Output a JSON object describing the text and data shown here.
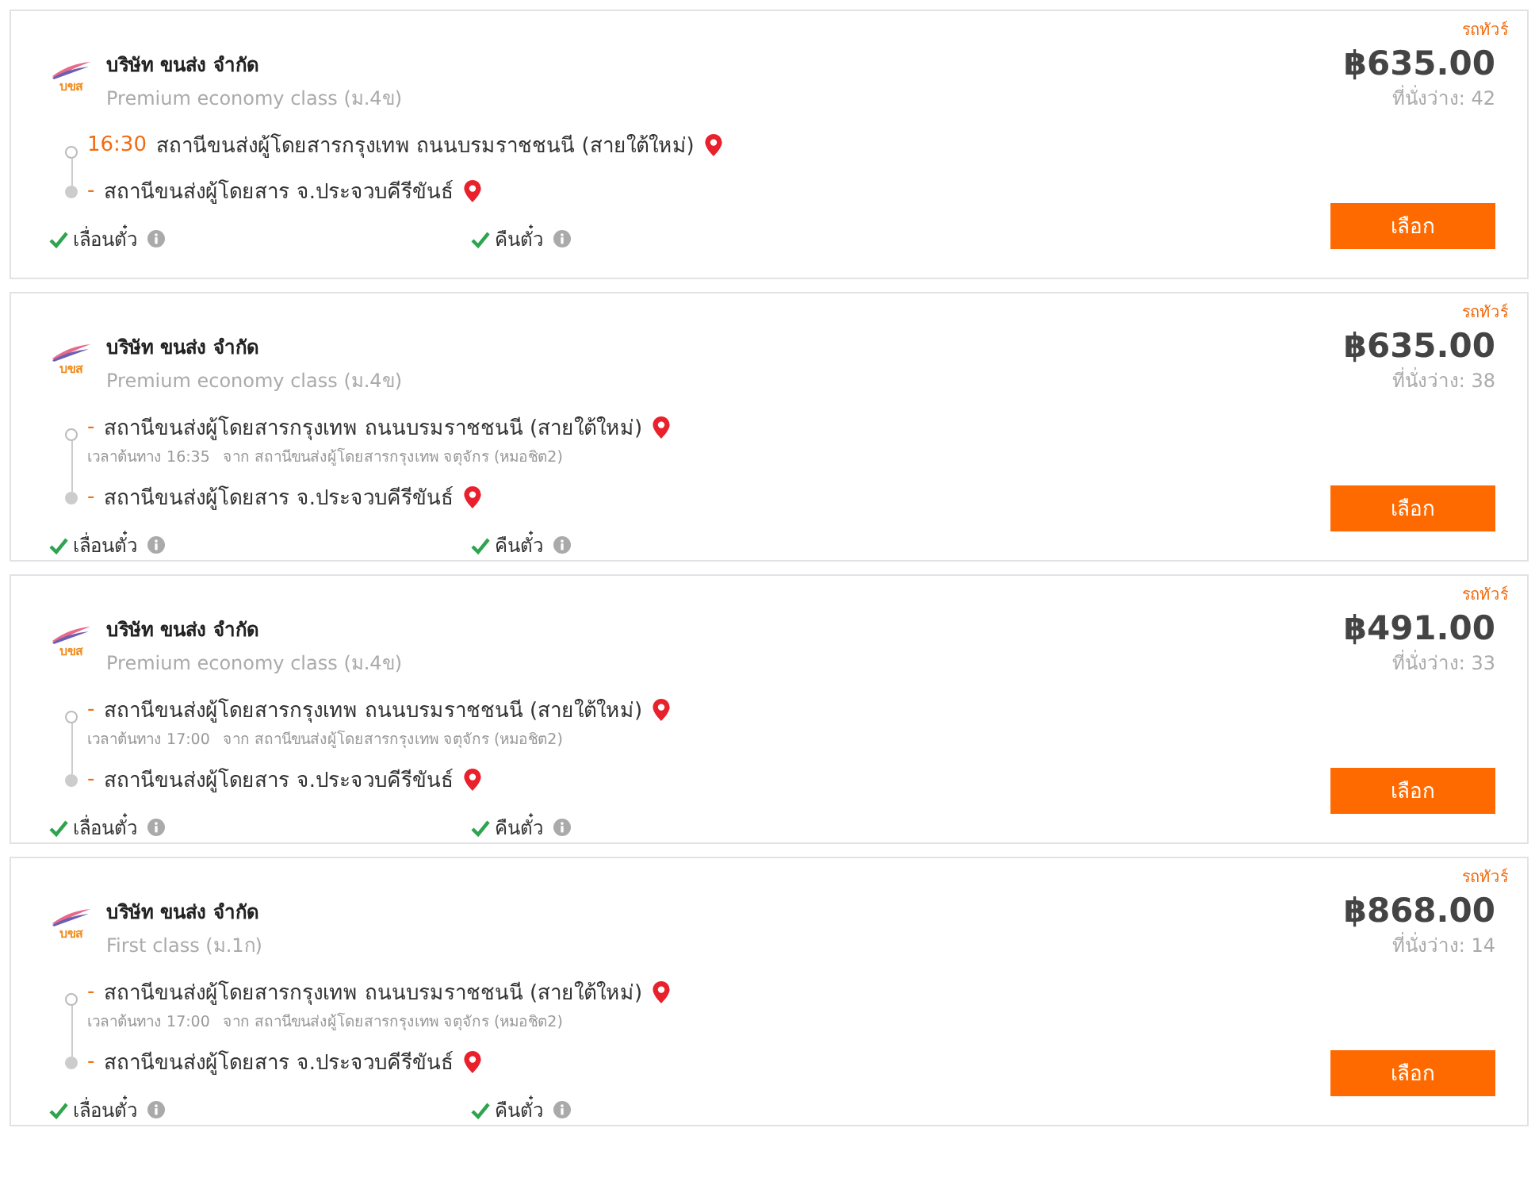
{
  "trips": [
    {
      "bus_type": "รถทัวร์",
      "logo_text": "บขส",
      "company": "บริษัท ขนส่ง จำกัด",
      "class": "Premium economy class (ม.4ข)",
      "price": "฿635.00",
      "seats": "ที่นั่งว่าง: 42",
      "departure": {
        "time": "16:30",
        "station": "สถานีขนส่งผู้โดยสารกรุงเทพ ถนนบรมราชชนนี (สายใต้ใหม่)"
      },
      "arrival": {
        "time": "-",
        "station": "สถานีขนส่งผู้โดยสาร จ.ประจวบคีรีขันธ์"
      },
      "features": [
        {
          "label": "เลื่อนตั๋ว",
          "checked": true
        },
        {
          "label": "คืนตั๋ว",
          "checked": true
        }
      ],
      "button": "เลือก"
    },
    {
      "bus_type": "รถทัวร์",
      "logo_text": "บขส",
      "company": "บริษัท ขนส่ง จำกัด",
      "class": "Premium economy class (ม.4ข)",
      "price": "฿635.00",
      "seats": "ที่นั่งว่าง: 38",
      "departure": {
        "time": "-",
        "station": "สถานีขนส่งผู้โดยสารกรุงเทพ ถนนบรมราชชนนี (สายใต้ใหม่)",
        "origin_time": "เวลาต้นทาง 16:35",
        "origin": "จาก สถานีขนส่งผู้โดยสารกรุงเทพ จตุจักร (หมอชิต2)"
      },
      "arrival": {
        "time": "-",
        "station": "สถานีขนส่งผู้โดยสาร จ.ประจวบคีรีขันธ์"
      },
      "features": [
        {
          "label": "เลื่อนตั๋ว",
          "checked": true
        },
        {
          "label": "คืนตั๋ว",
          "checked": true
        }
      ],
      "button": "เลือก"
    },
    {
      "bus_type": "รถทัวร์",
      "logo_text": "บขส",
      "company": "บริษัท ขนส่ง จำกัด",
      "class": "Premium economy class (ม.4ข)",
      "price": "฿491.00",
      "seats": "ที่นั่งว่าง: 33",
      "departure": {
        "time": "-",
        "station": "สถานีขนส่งผู้โดยสารกรุงเทพ ถนนบรมราชชนนี (สายใต้ใหม่)",
        "origin_time": "เวลาต้นทาง 17:00",
        "origin": "จาก สถานีขนส่งผู้โดยสารกรุงเทพ จตุจักร (หมอชิต2)"
      },
      "arrival": {
        "time": "-",
        "station": "สถานีขนส่งผู้โดยสาร จ.ประจวบคีรีขันธ์"
      },
      "features": [
        {
          "label": "เลื่อนตั๋ว",
          "checked": true
        },
        {
          "label": "คืนตั๋ว",
          "checked": true
        }
      ],
      "button": "เลือก"
    },
    {
      "bus_type": "รถทัวร์",
      "logo_text": "บขส",
      "company": "บริษัท ขนส่ง จำกัด",
      "class": "First class (ม.1ก)",
      "price": "฿868.00",
      "seats": "ที่นั่งว่าง: 14",
      "departure": {
        "time": "-",
        "station": "สถานีขนส่งผู้โดยสารกรุงเทพ ถนนบรมราชชนนี (สายใต้ใหม่)",
        "origin_time": "เวลาต้นทาง 17:00",
        "origin": "จาก สถานีขนส่งผู้โดยสารกรุงเทพ จตุจักร (หมอชิต2)"
      },
      "arrival": {
        "time": "-",
        "station": "สถานีขนส่งผู้โดยสาร จ.ประจวบคีรีขันธ์"
      },
      "features": [
        {
          "label": "เลื่อนตั๋ว",
          "checked": true
        },
        {
          "label": "คืนตั๋ว",
          "checked": true
        }
      ],
      "button": "เลือก"
    }
  ]
}
